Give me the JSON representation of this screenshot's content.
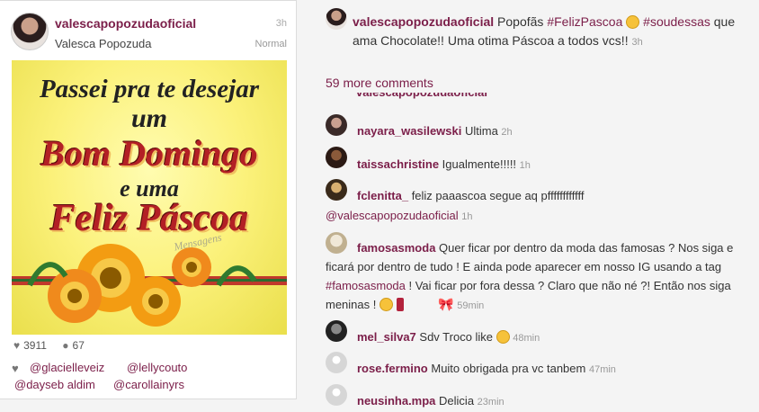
{
  "post": {
    "username": "valescapopozudaoficial",
    "time": "3h",
    "full_name": "Valesca Popozuda",
    "filter": "Normal",
    "image": {
      "line1": "Passei pra te desejar",
      "line2": "um",
      "line3": "Bom Domingo",
      "line4": "e uma",
      "line5": "Feliz Páscoa",
      "watermark": "Mensagens"
    },
    "likes": "3911",
    "comments_count": "67",
    "tagged": [
      "@glacielleveiz",
      "@lellycouto",
      "@dayseb aldim",
      "@carollainyrs"
    ]
  },
  "caption": {
    "username": "valescapopozudaoficial",
    "text1": " Popofãs ",
    "hashtag1": "#FelizPascoa",
    "hashtag2": "#soudessas",
    "text2": " que ama Chocolate!! Uma otima Páscoa a todos vcs!! ",
    "time": "3h"
  },
  "more_comments": "59 more comments",
  "comments": [
    {
      "user": "nayara_wasilewski",
      "text": " Ultima ",
      "time": "2h"
    },
    {
      "user": "taissachristine",
      "text": " Igualmente!!!!! ",
      "time": "1h"
    },
    {
      "user": "fclenitta_",
      "text": " feliz paaascoa segue aq pffffffffffff",
      "mention": "@valescapopozudaoficial",
      "time": "1h"
    },
    {
      "user": "famosasmoda",
      "text": " Quer ficar por dentro da moda das famosas ? Nos siga e ficará por dentro de tudo ! E ainda pode aparecer em nosso IG usando a tag ",
      "hashtag": "#famosasmoda",
      "text2": " ! Vai ficar por fora dessa ? Claro que não né ?! Então nos siga meninas ! ",
      "time": "59min"
    },
    {
      "user": "mel_silva7",
      "text": " Sdv Troco like ",
      "time": "48min"
    },
    {
      "user": "rose.fermino",
      "text": " Muito obrigada pra vc tanbem ",
      "time": "47min"
    },
    {
      "user": "neusinha.mpa",
      "text": " Delicia ",
      "time": "23min"
    }
  ],
  "colors": {
    "accent": "#7b1e49",
    "background": "#f4f4f4"
  }
}
